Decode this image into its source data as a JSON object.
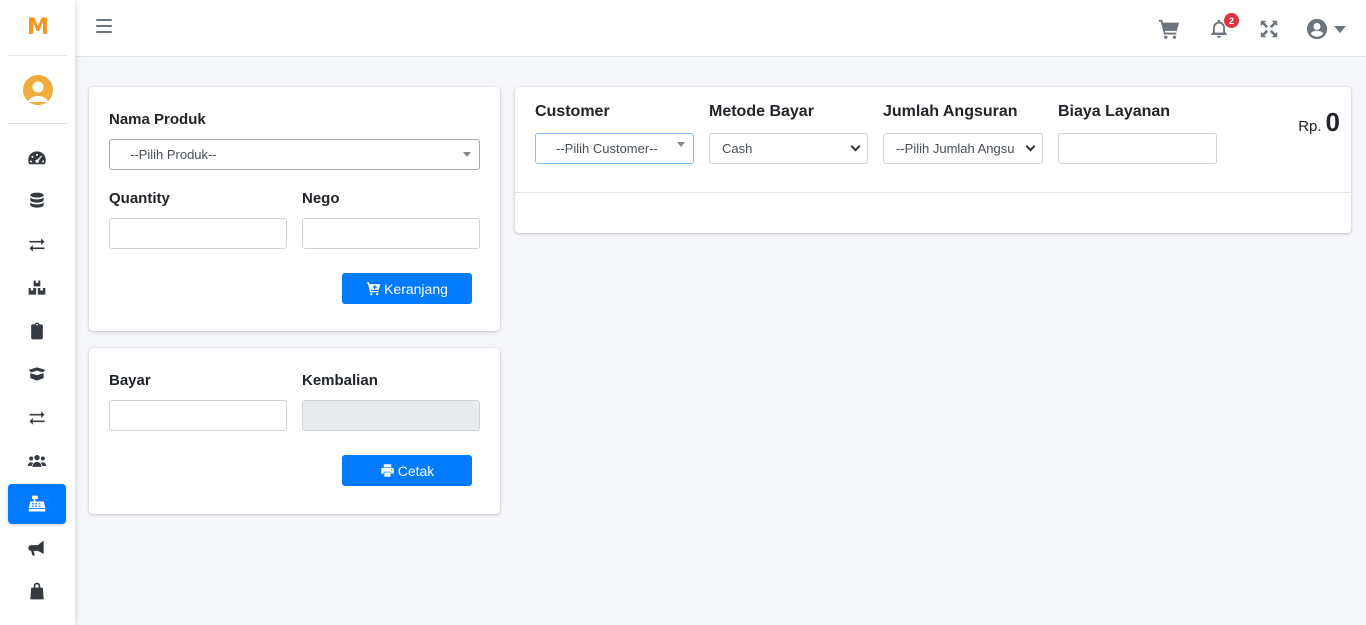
{
  "brand": {
    "logo_text": "M",
    "color": "#f7931e"
  },
  "sidebar": {
    "items": [
      {
        "name": "dashboard",
        "icon": "tachometer-icon",
        "active": false
      },
      {
        "name": "database",
        "icon": "database-icon",
        "active": false
      },
      {
        "name": "transfer",
        "icon": "exchange-icon",
        "active": false
      },
      {
        "name": "stock",
        "icon": "boxes-icon",
        "active": false
      },
      {
        "name": "clipboard",
        "icon": "clipboard-icon",
        "active": false
      },
      {
        "name": "packages",
        "icon": "box-open-icon",
        "active": false
      },
      {
        "name": "transfer-2",
        "icon": "exchange-icon",
        "active": false
      },
      {
        "name": "users",
        "icon": "users-icon",
        "active": false
      },
      {
        "name": "cash-register",
        "icon": "cash-register-icon",
        "active": true
      },
      {
        "name": "announcement",
        "icon": "bullhorn-icon",
        "active": false
      },
      {
        "name": "shopping",
        "icon": "shopping-bag-icon",
        "active": false
      }
    ]
  },
  "navbar": {
    "notification_count": "2",
    "icons": [
      "hamburger-icon",
      "cart-icon",
      "bell-icon",
      "expand-icon",
      "user-circle-icon"
    ]
  },
  "product_form": {
    "product_label": "Nama Produk",
    "product_placeholder": "--Pilih Produk--",
    "quantity_label": "Quantity",
    "nego_label": "Nego",
    "cart_button": "Keranjang"
  },
  "payment_form": {
    "bayar_label": "Bayar",
    "kembalian_label": "Kembalian",
    "print_button": "Cetak"
  },
  "order_panel": {
    "customer_label": "Customer",
    "customer_placeholder": "--Pilih Customer--",
    "metode_label": "Metode Bayar",
    "metode_value": "Cash",
    "angsuran_label": "Jumlah Angsuran",
    "angsuran_value": "--Pilih Jumlah Angsu",
    "biaya_label": "Biaya Layanan",
    "currency": "Rp.",
    "total": "0"
  },
  "colors": {
    "primary": "#007bff",
    "badge": "#dc3545",
    "background": "#f4f6f9"
  }
}
